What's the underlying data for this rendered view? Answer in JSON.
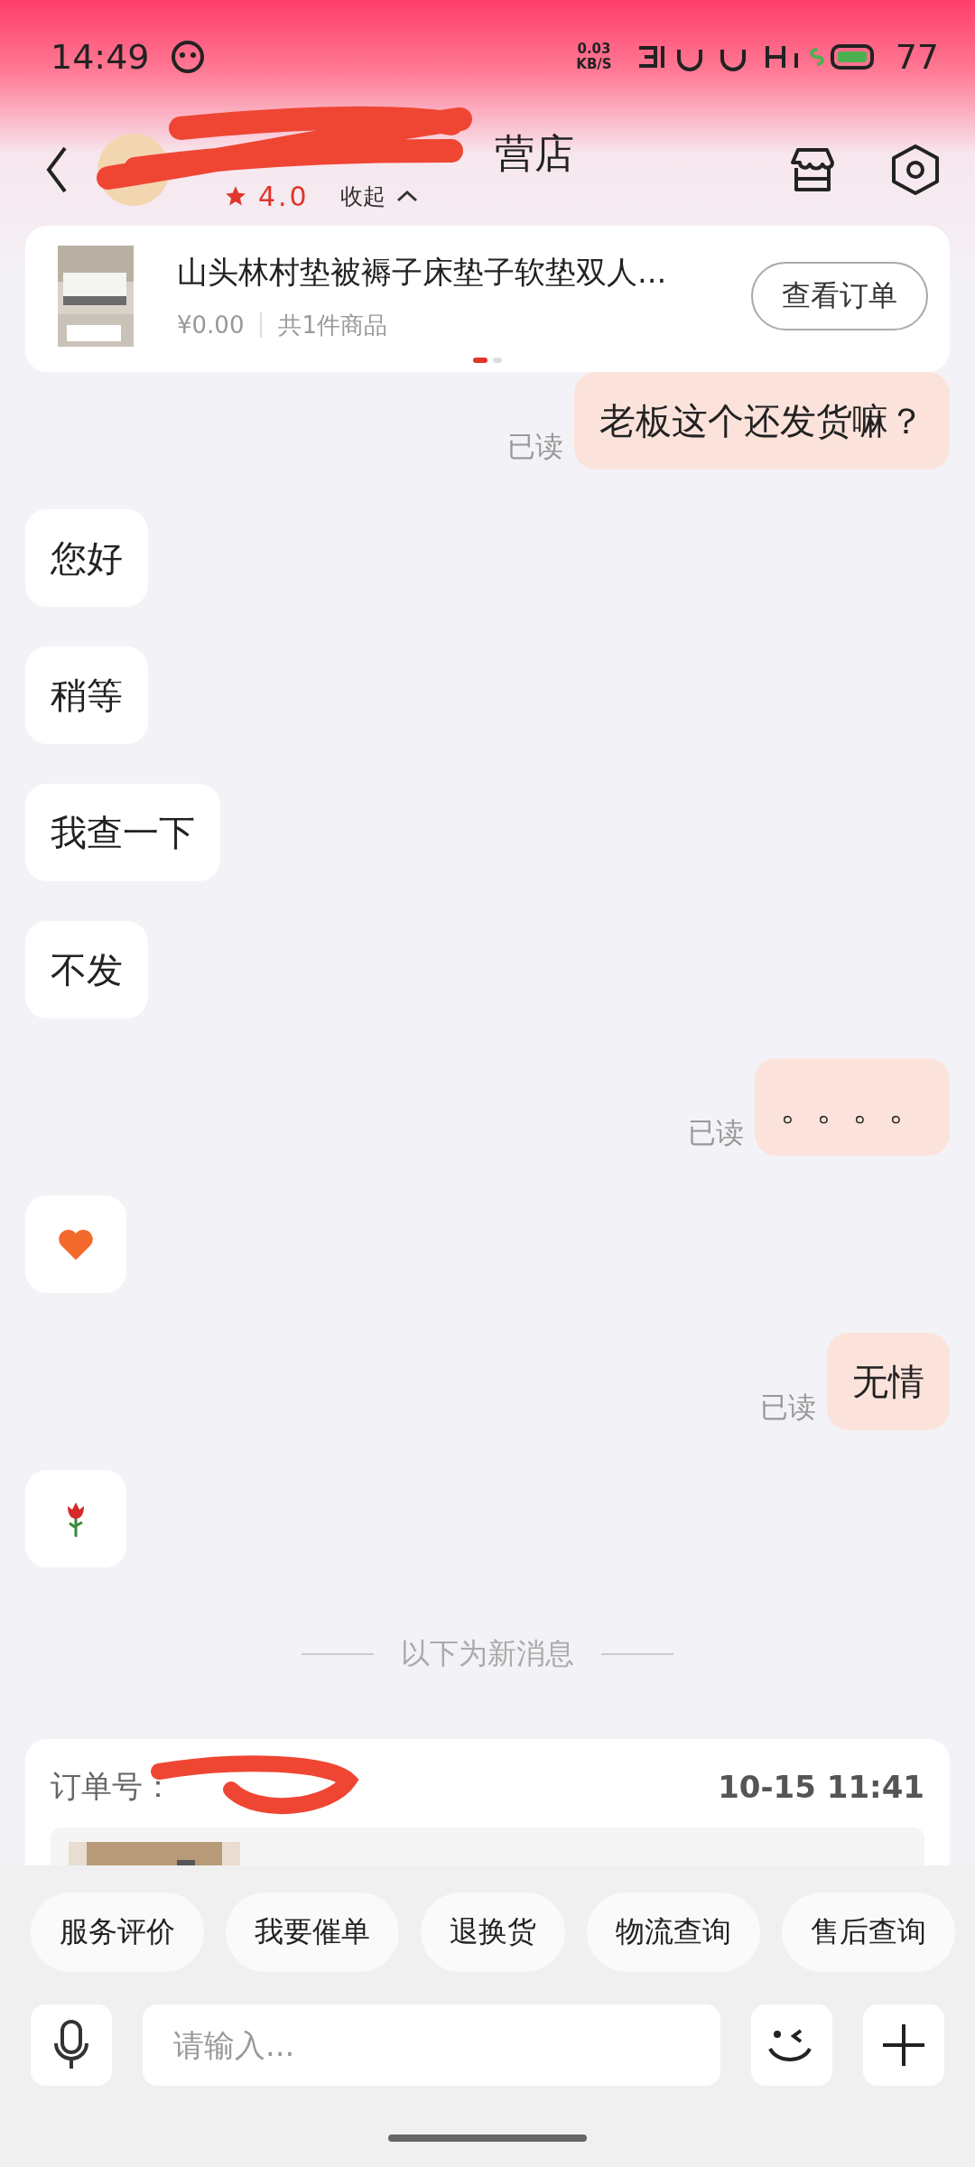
{
  "status_bar": {
    "time": "14:49",
    "speed_value": "0.03",
    "speed_unit": "KB/S",
    "battery": "77"
  },
  "header": {
    "shop_name": "营店",
    "rating": "4.0",
    "collapse": "收起"
  },
  "product": {
    "title": "山头林村垫被褥子床垫子软垫双人...",
    "price": "¥0.00",
    "count": "共1件商品",
    "button": "查看订单",
    "pager": [
      {
        "selected": true
      },
      {
        "selected": false
      }
    ]
  },
  "messages": [
    {
      "outgoing": true,
      "kind": "text",
      "text": "老板这个还发货嘛？",
      "status": "已读"
    },
    {
      "outgoing": false,
      "kind": "text",
      "text": "您好"
    },
    {
      "outgoing": false,
      "kind": "text",
      "text": "稍等"
    },
    {
      "outgoing": false,
      "kind": "text",
      "text": "我查一下"
    },
    {
      "outgoing": false,
      "kind": "text",
      "text": "不发"
    },
    {
      "outgoing": true,
      "kind": "text",
      "text": "。。。。",
      "status": "已读"
    },
    {
      "outgoing": false,
      "kind": "heart"
    },
    {
      "outgoing": true,
      "kind": "text",
      "text": "无情",
      "status": "已读"
    },
    {
      "outgoing": false,
      "kind": "rose"
    }
  ],
  "divider": "以下为新消息",
  "order": {
    "label": "订单号：",
    "time": "10-15 11:41"
  },
  "quick_replies": [
    "服务评价",
    "我要催单",
    "退换货",
    "物流查询",
    "售后查询"
  ],
  "input": {
    "placeholder": "请输入..."
  }
}
